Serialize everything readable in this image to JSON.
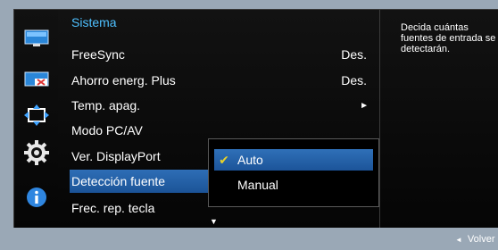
{
  "panel": {
    "title": "Sistema",
    "items": [
      {
        "label": "FreeSync",
        "value": "Des."
      },
      {
        "label": "Ahorro energ. Plus",
        "value": "Des."
      },
      {
        "label": "Temp. apag.",
        "value": "►"
      },
      {
        "label": "Modo PC/AV",
        "value": ""
      },
      {
        "label": "Ver. DisplayPort",
        "value": ""
      },
      {
        "label": "Detección fuente",
        "value": ""
      },
      {
        "label": "Frec. rep. tecla",
        "value": ""
      }
    ],
    "scroll_indicator": "▼"
  },
  "submenu": {
    "options": [
      {
        "label": "Auto",
        "checked_glyph": "✔",
        "selected": true
      },
      {
        "label": "Manual",
        "checked_glyph": "",
        "selected": false
      }
    ]
  },
  "help": {
    "text": "Decida cuántas fuentes de entrada se detectarán."
  },
  "footer": {
    "back_glyph": "◄",
    "back_label": "Volver"
  },
  "icons": [
    "picture-icon",
    "color-icon",
    "size-position-icon",
    "system-gear-icon",
    "info-icon"
  ],
  "colors": {
    "accent_title": "#4ec0ff",
    "selection": "#1f5aa0",
    "check": "#e8d22a",
    "background": "#9aa8b6"
  }
}
